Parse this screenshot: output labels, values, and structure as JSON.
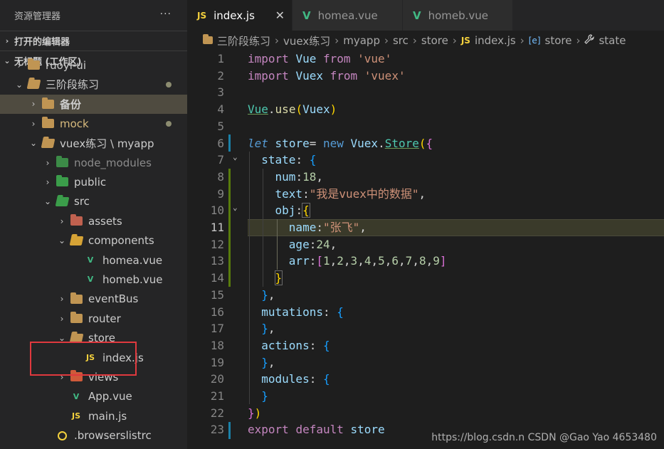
{
  "sidebar": {
    "title": "资源管理器",
    "more": "···",
    "open_editors": "打开的编辑器",
    "workspace": "无标题 (工作区)",
    "tree": [
      {
        "label": "ruoyi-ui",
        "depth": 1,
        "type": "folder",
        "twisty": ">",
        "icon": "folder-icon"
      },
      {
        "label": "三阶段练习",
        "depth": 1,
        "type": "folder-open",
        "twisty": "v",
        "icon": "folder-open-icon",
        "dot": true
      },
      {
        "label": "备份",
        "depth": 2,
        "type": "folder",
        "twisty": ">",
        "icon": "folder-icon",
        "selected": true,
        "bold": true
      },
      {
        "label": "mock",
        "depth": 2,
        "type": "folder",
        "twisty": ">",
        "icon": "folder-icon",
        "dot": true,
        "orange": true
      },
      {
        "label": "vuex练习 \\ myapp",
        "depth": 2,
        "type": "folder-open",
        "twisty": "v",
        "icon": "folder-open-icon"
      },
      {
        "label": "node_modules",
        "depth": 3,
        "type": "folder",
        "twisty": ">",
        "icon": "node-folder-icon",
        "dim": true
      },
      {
        "label": "public",
        "depth": 3,
        "type": "folder",
        "twisty": ">",
        "icon": "public-folder-icon"
      },
      {
        "label": "src",
        "depth": 3,
        "type": "folder-open",
        "twisty": "v",
        "icon": "src-folder-icon"
      },
      {
        "label": "assets",
        "depth": 4,
        "type": "folder",
        "twisty": ">",
        "icon": "assets-folder-icon"
      },
      {
        "label": "components",
        "depth": 4,
        "type": "folder-open",
        "twisty": "v",
        "icon": "components-folder-icon"
      },
      {
        "label": "homea.vue",
        "depth": 5,
        "type": "vue",
        "icon": "vue-file-icon"
      },
      {
        "label": "homeb.vue",
        "depth": 5,
        "type": "vue",
        "icon": "vue-file-icon"
      },
      {
        "label": "eventBus",
        "depth": 4,
        "type": "folder",
        "twisty": ">",
        "icon": "folder-icon"
      },
      {
        "label": "router",
        "depth": 4,
        "type": "folder",
        "twisty": ">",
        "icon": "folder-icon"
      },
      {
        "label": "store",
        "depth": 4,
        "type": "folder-open",
        "twisty": "v",
        "icon": "folder-open-icon"
      },
      {
        "label": "index.js",
        "depth": 5,
        "type": "js",
        "icon": "js-file-icon"
      },
      {
        "label": "views",
        "depth": 4,
        "type": "folder",
        "twisty": ">",
        "icon": "views-folder-icon"
      },
      {
        "label": "App.vue",
        "depth": 4,
        "type": "vue",
        "icon": "vue-file-icon"
      },
      {
        "label": "main.js",
        "depth": 4,
        "type": "js",
        "icon": "js-file-icon"
      },
      {
        "label": ".browserslistrc",
        "depth": 3,
        "type": "file",
        "icon": "browserslist-file-icon"
      }
    ]
  },
  "tabs": [
    {
      "label": "index.js",
      "icon": "JS",
      "active": true,
      "close": "✕"
    },
    {
      "label": "homea.vue",
      "icon": "V",
      "active": false
    },
    {
      "label": "homeb.vue",
      "icon": "V",
      "active": false
    }
  ],
  "breadcrumb": [
    {
      "label": "三阶段练习",
      "icon": "folder-icon"
    },
    {
      "label": "vuex练习"
    },
    {
      "label": "myapp"
    },
    {
      "label": "src"
    },
    {
      "label": "store"
    },
    {
      "label": "index.js",
      "icon": "JS"
    },
    {
      "label": "store",
      "icon": "[e]"
    },
    {
      "label": "state",
      "icon": "wrench-icon"
    }
  ],
  "editor": {
    "current_line": 11,
    "lines": [
      {
        "n": "1"
      },
      {
        "n": "2"
      },
      {
        "n": "3"
      },
      {
        "n": "4"
      },
      {
        "n": "5"
      },
      {
        "n": "6"
      },
      {
        "n": "7"
      },
      {
        "n": "8"
      },
      {
        "n": "9"
      },
      {
        "n": "10"
      },
      {
        "n": "11"
      },
      {
        "n": "12"
      },
      {
        "n": "13"
      },
      {
        "n": "14"
      },
      {
        "n": "15"
      },
      {
        "n": "16"
      },
      {
        "n": "17"
      },
      {
        "n": "18"
      },
      {
        "n": "19"
      },
      {
        "n": "20"
      },
      {
        "n": "21"
      },
      {
        "n": "22"
      },
      {
        "n": "23"
      }
    ],
    "tokens": {
      "import": "import",
      "from": "from",
      "vue_str": "'vue'",
      "vuex_str": "'vuex'",
      "Vue": "Vue",
      "Vuex": "Vuex",
      "use": "use",
      "let": "let",
      "store": "store",
      "new": "new",
      "Store": "Store",
      "state": "state",
      "num": "num",
      "num_val": "18",
      "text": "text",
      "text_val": "\"我是vuex中的数据\"",
      "obj": "obj",
      "name": "name",
      "name_val": "\"张飞\"",
      "age": "age",
      "age_val": "24",
      "arr": "arr",
      "arr_vals": [
        "1",
        "2",
        "3",
        "4",
        "5",
        "6",
        "7",
        "8",
        "9"
      ],
      "mutations": "mutations",
      "actions": "actions",
      "modules": "modules",
      "export": "export",
      "default": "default"
    }
  },
  "watermark": "https://blog.csdn.n CSDN @Gao Yao 4653480",
  "colors": {
    "accent_selected": "#4f4b40",
    "highlight_box": "#e0393e",
    "js_yellow": "#f4d13d",
    "vue_green": "#41b883"
  }
}
